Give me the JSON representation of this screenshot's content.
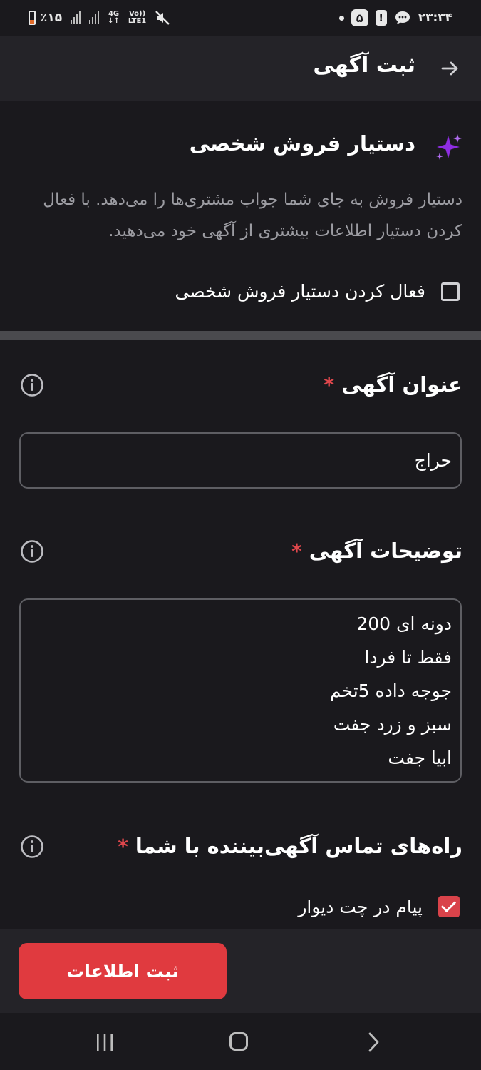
{
  "status_bar": {
    "battery": "٪۱۵",
    "network_top": "4G",
    "network_bottom": "LTE1",
    "volte": "Vo))",
    "time": "۲۳:۳۴",
    "notif_badge": "۵"
  },
  "app_bar": {
    "title": "ثبت آگهی"
  },
  "assistant": {
    "title": "دستیار فروش شخصی",
    "description": "دستیار فروش به جای شما جواب مشتری‌ها را می‌دهد. با فعال کردن دستیار اطلاعات بیشتری از آگهی خود می‌دهید.",
    "enable_label": "فعال کردن دستیار فروش شخصی",
    "enabled": false
  },
  "title_field": {
    "label": "عنوان آگهی",
    "required_mark": "*",
    "value": "حراج"
  },
  "description_field": {
    "label": "توضیحات آگهی",
    "required_mark": "*",
    "lines": [
      "دونه ای 200",
      "فقط تا فردا",
      "جوجه  داده 5تخم",
      "سبز و زرد جفت",
      "ابیا جفت"
    ]
  },
  "contact": {
    "label": "راه‌های تماس آگهی‌بیننده با شما",
    "required_mark": "*",
    "option_label": "پیام در چت دیوار",
    "option_checked": true
  },
  "submit": {
    "label": "ثبت اطلاعات"
  },
  "colors": {
    "accent": "#e03a3f",
    "sparkle": "#8e2de2",
    "background": "#1a191d"
  }
}
